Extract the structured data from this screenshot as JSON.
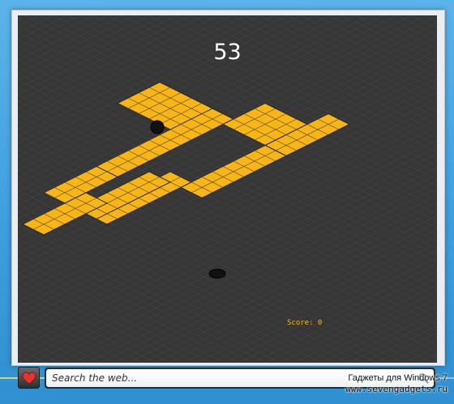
{
  "game": {
    "counter": "53",
    "score_label": "Score: 0",
    "ball_icon": "black-ball",
    "colors": {
      "background": "#363636",
      "grid": "#424242",
      "track": "#f7b51c",
      "track_lines": "#5a4305",
      "track_edge": "#2a2a2a",
      "score": "#f3b81e",
      "counter": "#ffffff"
    }
  },
  "search": {
    "placeholder": "Search the web...",
    "value": "",
    "favorite_icon": "heart-icon",
    "go_icon": "search-icon"
  },
  "watermark": {
    "line1": "Гаджеты для Windows 7",
    "line2": "www.sevengadgets.ru"
  }
}
